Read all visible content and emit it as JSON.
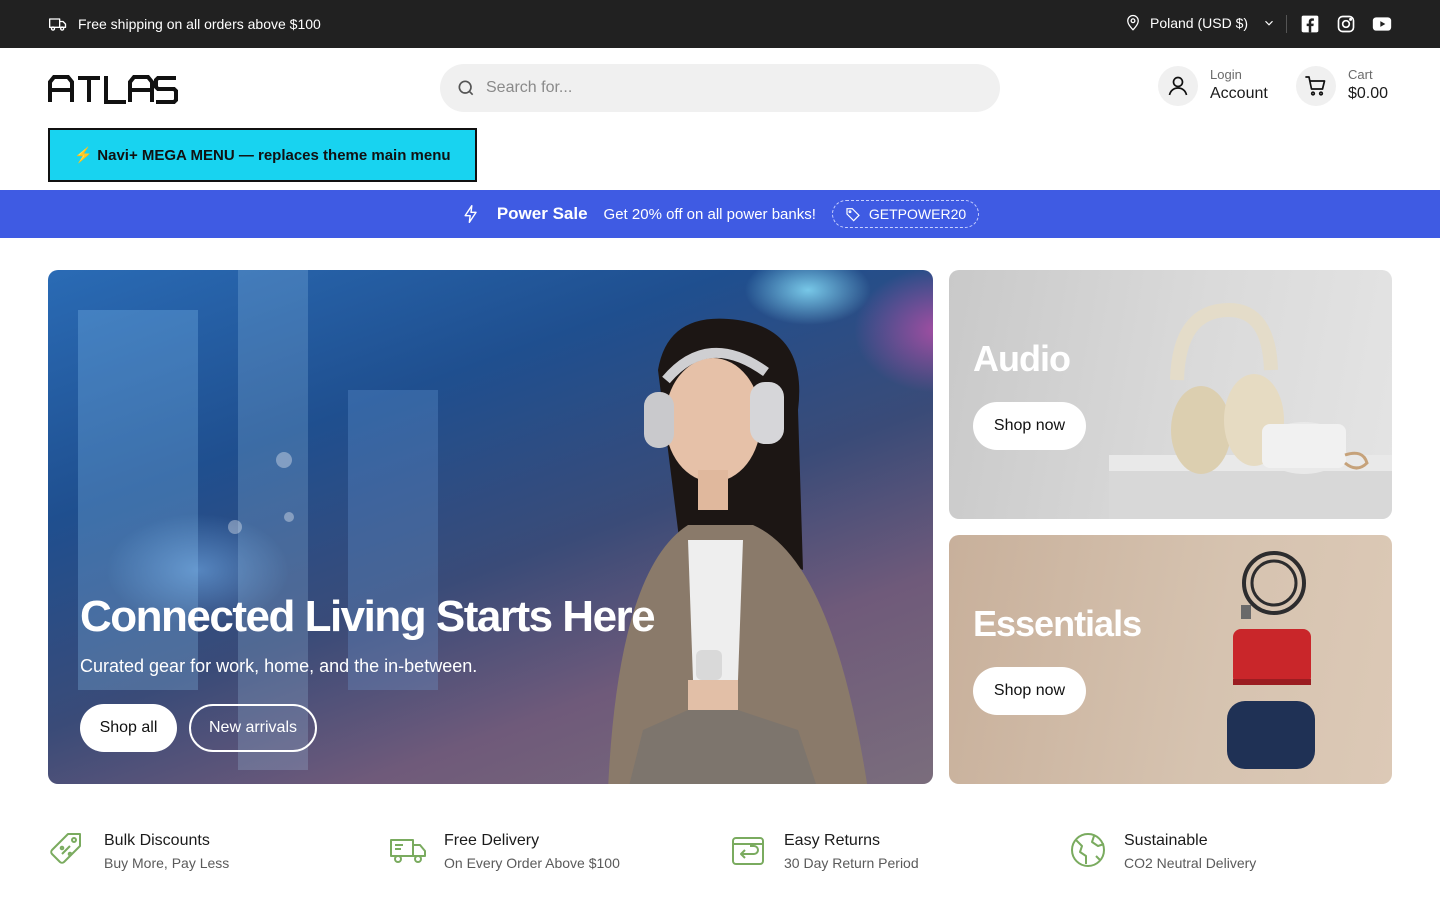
{
  "announcement": {
    "shipping_text": "Free shipping on all orders above $100",
    "region": "Poland (USD $)",
    "social": [
      "facebook-icon",
      "instagram-icon",
      "youtube-icon"
    ]
  },
  "header": {
    "logo": "ATLAS",
    "search_placeholder": "Search for...",
    "account_small": "Login",
    "account_big": "Account",
    "cart_small": "Cart",
    "cart_big": "$0.00",
    "mega_menu": "⚡ Navi+ MEGA MENU — replaces theme main menu"
  },
  "promo": {
    "title": "Power Sale",
    "text": "Get 20% off on all power banks!",
    "code": "GETPOWER20",
    "color": "#3f5be3"
  },
  "hero": {
    "title": "Connected Living Starts Here",
    "subtitle": "Curated gear for work, home, and the in-between.",
    "primary_button": "Shop all",
    "secondary_button": "New arrivals"
  },
  "tiles": [
    {
      "title": "Audio",
      "button": "Shop now"
    },
    {
      "title": "Essentials",
      "button": "Shop now"
    }
  ],
  "features": [
    {
      "icon": "discount-tag-icon",
      "title": "Bulk Discounts",
      "subtitle": "Buy More, Pay Less"
    },
    {
      "icon": "delivery-truck-icon",
      "title": "Free Delivery",
      "subtitle": "On Every Order Above $100"
    },
    {
      "icon": "return-box-icon",
      "title": "Easy Returns",
      "subtitle": "30 Day Return Period"
    },
    {
      "icon": "globe-icon",
      "title": "Sustainable",
      "subtitle": "CO2 Neutral Delivery"
    }
  ],
  "colors": {
    "accent_green": "#7aab5f",
    "topbar": "#212121",
    "mega_menu": "#18d3f0"
  }
}
